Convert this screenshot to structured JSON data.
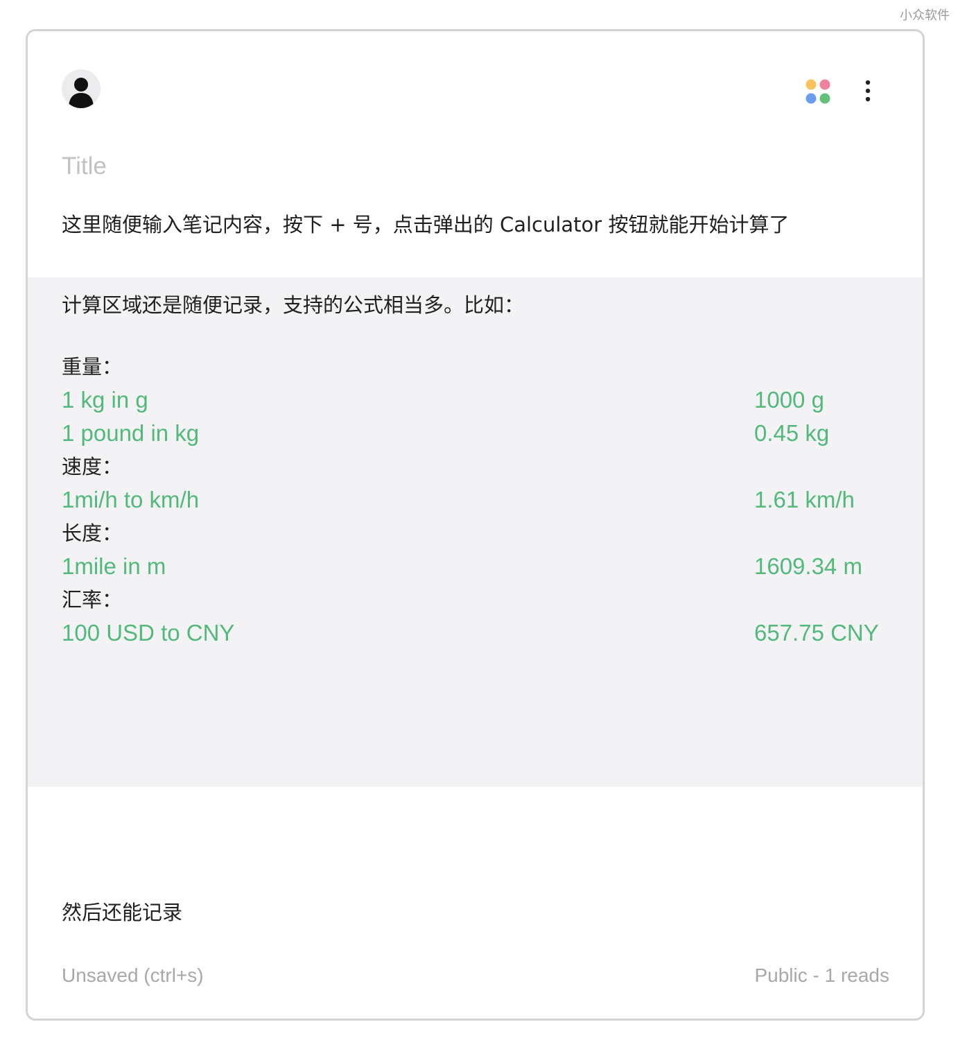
{
  "watermark": "小众软件",
  "header": {
    "avatar_icon": "user-avatar-icon",
    "apps_icon": "colored-dots-apps-icon",
    "menu_icon": "vertical-dots-menu-icon",
    "dot_colors": [
      "#f9c25a",
      "#f0829d",
      "#6c9cf0",
      "#62c27c"
    ]
  },
  "note": {
    "title_placeholder": "Title",
    "intro": "这里随便输入笔记内容，按下 + 号，点击弹出的 Calculator 按钮就能开始计算了",
    "calculator": {
      "intro": "计算区域还是随便记录，支持的公式相当多。比如：",
      "lines": [
        {
          "kind": "heading",
          "text": "重量："
        },
        {
          "kind": "expr",
          "text": "1 kg in g",
          "result": "1000 g"
        },
        {
          "kind": "expr",
          "text": "1 pound in kg",
          "result": "0.45 kg"
        },
        {
          "kind": "heading",
          "text": "速度："
        },
        {
          "kind": "expr",
          "text": "1mi/h to km/h",
          "result": "1.61 km/h"
        },
        {
          "kind": "heading",
          "text": "长度："
        },
        {
          "kind": "expr",
          "text": "1mile in m",
          "result": "1609.34 m"
        },
        {
          "kind": "heading",
          "text": "汇率："
        },
        {
          "kind": "expr",
          "text": "100 USD to CNY",
          "result": "657.75 CNY"
        }
      ]
    },
    "outro": "然后还能记录"
  },
  "footer": {
    "save_status": "Unsaved (ctrl+s)",
    "visibility": "Public - 1 reads"
  },
  "colors": {
    "result_green": "#52b97a",
    "calc_background": "#f3f3f5",
    "muted_text": "#a8a8aa"
  }
}
